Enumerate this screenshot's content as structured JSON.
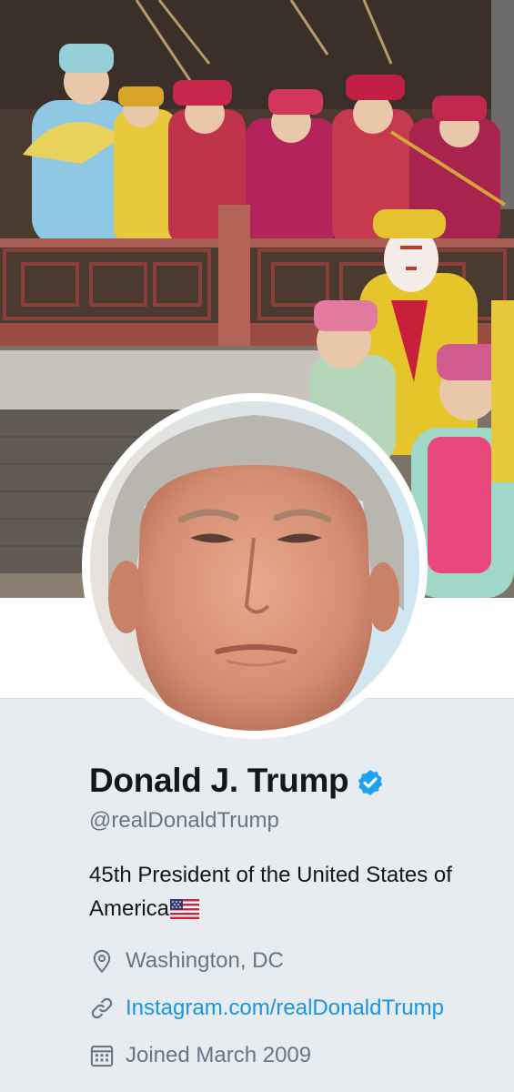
{
  "profile": {
    "name": "Donald J. Trump",
    "handle": "@realDonaldTrump",
    "bio": "45th President of the United States of America",
    "bio_emoji": "us-flag-icon",
    "verified": true,
    "location": "Washington, DC",
    "url": "Instagram.com/realDonaldTrump",
    "joined": "Joined March 2009"
  },
  "icons": {
    "location": "location-pin-icon",
    "url": "link-icon",
    "joined": "calendar-icon",
    "verified": "verified-badge-icon"
  },
  "colors": {
    "background": "#e6ecf0",
    "name_text": "#14171a",
    "secondary_text": "#657786",
    "link": "#1b95e0",
    "verified_badge": "#1da1f2"
  }
}
